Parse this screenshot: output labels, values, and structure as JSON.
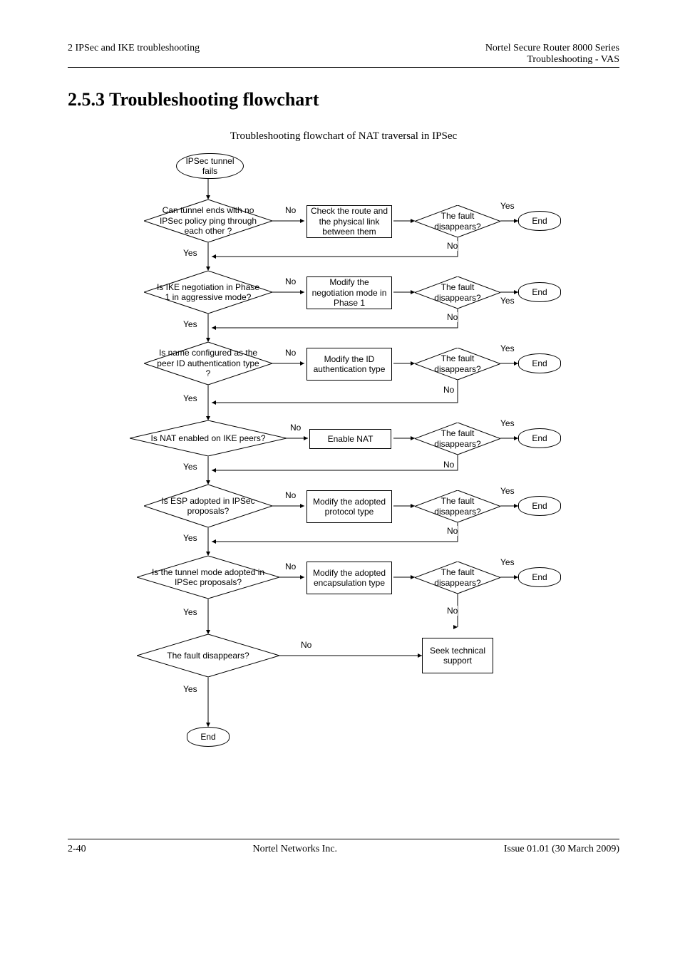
{
  "header": {
    "left": "2 IPSec and IKE troubleshooting",
    "right_top": "Nortel Secure Router 8000 Series",
    "right_bottom": "Troubleshooting - VAS"
  },
  "heading": "2.5.3 Troubleshooting flowchart",
  "caption": "Troubleshooting flowchart of NAT traversal in IPSec",
  "flow": {
    "start": "IPSec tunnel fails",
    "d1": "Can tunnel ends with no IPSec policy ping through each other ?",
    "p1": "Check the route and the physical link between them",
    "f1": "The fault disappears?",
    "d2": "Is IKE negotiation in Phase 1 in aggressive mode?",
    "p2": "Modify the negotiation mode in Phase 1",
    "f2": "The fault disappears?",
    "d3": "Is name configured as the peer ID authentication type ?",
    "p3": "Modify the ID authentication type",
    "f3": "The fault disappears?",
    "d4": "Is NAT enabled on IKE peers?",
    "p4": "Enable NAT",
    "f4": "The fault disappears?",
    "d5": "Is ESP adopted in IPSec proposals?",
    "p5": "Modify the adopted protocol type",
    "f5": "The fault disappears?",
    "d6": "Is the tunnel mode adopted in IPSec proposals?",
    "p6": "Modify the adopted encapsulation type",
    "f6": "The fault disappears?",
    "d7": "The fault disappears?",
    "seek": "Seek technical support",
    "end": "End",
    "yes": "Yes",
    "no": "No"
  },
  "footer": {
    "left": "2-40",
    "center": "Nortel Networks Inc.",
    "right": "Issue  01.01  (30  March  2009)"
  }
}
